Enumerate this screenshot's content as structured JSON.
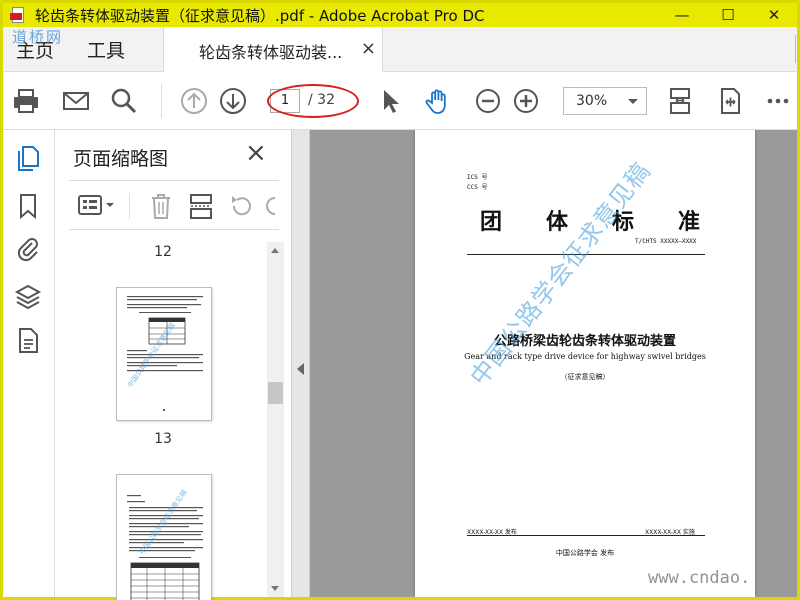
{
  "window": {
    "title": "轮齿条转体驱动装置（征求意见稿）.pdf - Adobe Acrobat Pro DC",
    "minimize": "—",
    "maximize": "☐",
    "close": "✕"
  },
  "tabs": {
    "home": "主页",
    "tools": "工具",
    "document": "轮齿条转体驱动装...",
    "doc_close": "×"
  },
  "watermark_top": "道桥网",
  "toolbar": {
    "current_page": "1",
    "total_pages": "/ 32",
    "zoom": "30%",
    "icons": [
      "print-icon",
      "email-icon",
      "search-icon",
      "page-up-icon",
      "page-down-icon",
      "select-cursor-icon",
      "hand-icon",
      "zoom-out-icon",
      "zoom-in-icon",
      "page-fit-icon",
      "rotate-view-icon",
      "more-icon"
    ]
  },
  "rail": {
    "icons": [
      "page-thumbnails-icon",
      "bookmark-icon",
      "attachment-icon",
      "layers-icon",
      "document-properties-icon"
    ]
  },
  "thumbnail_panel": {
    "title": "页面缩略图",
    "close": "×",
    "page_labels": [
      "12",
      "13"
    ]
  },
  "document": {
    "ics": "ICS 号",
    "ccs": "CCS 号",
    "standard_type_chars": [
      "团",
      "体",
      "标",
      "准"
    ],
    "standard_code": "T/CHTS XXXXX—XXXX",
    "title_cn": "公路桥梁齿轮齿条转体驱动装置",
    "title_en": "Gear and rack type drive device for highway swivel bridges",
    "draft_note": "（征求意见稿）",
    "publish_date": "XXXX-XX-XX 发布",
    "implement_date": "XXXX-XX-XX 实施",
    "issuer": "中国公路学会  发布",
    "diagonal_watermark": "中国公路学会征求意见稿"
  },
  "site_watermark": "www.cndao."
}
